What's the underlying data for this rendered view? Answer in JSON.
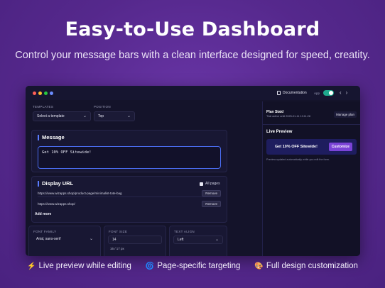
{
  "hero": {
    "title": "Easy-to-Use Dashboard",
    "subtitle": "Control your message bars with a clean interface designed for speed, creatity."
  },
  "window": {
    "documentation_label": "Documentation",
    "app_label": "App",
    "templates": {
      "label": "TEMPLATES",
      "value": "Select a template"
    },
    "position": {
      "label": "POSITION",
      "value": "Top"
    },
    "message": {
      "title": "Message",
      "value": "Get 10% OFF Sitewide!"
    },
    "display_url": {
      "title": "Display URL",
      "all_pages_label": "All pages",
      "urls": [
        {
          "value": "https://www.wizapps.shop/product-page/minimalist-tote-bag",
          "remove_label": "Remove"
        },
        {
          "value": "https://www.wizapps.shop/",
          "remove_label": "Remove"
        }
      ],
      "add_more_label": "Add more"
    },
    "font_family": {
      "label": "FONT FAMILY",
      "value": "Arial, sans-serif"
    },
    "font_size": {
      "label": "FONT SIZE",
      "value": "14",
      "note": "16 / 17 px"
    },
    "text_align": {
      "label": "TEXT ALIGN",
      "value": "Left"
    },
    "plan": {
      "title": "Plan Staid",
      "subtitle": "Trial active until 2025-01-11 13:11:28",
      "manage_label": "Manage plan"
    },
    "live_preview": {
      "title": "Live Preview",
      "bar_text": "Get 10% OFF Sitewide!",
      "customize_label": "Customize",
      "note": "Preview updated automatically while you edit the form."
    }
  },
  "features": [
    {
      "icon": "⚡",
      "label": "Live preview while editing"
    },
    {
      "icon": "🌀",
      "label": "Page-specific targeting"
    },
    {
      "icon": "🎨",
      "label": "Full design customization"
    }
  ],
  "colors": {
    "background": "#55288c",
    "window": "#14132a",
    "accent": "#4a6cf0",
    "toggle_on": "#1fa88e",
    "customize_button": "#7b43d6"
  }
}
